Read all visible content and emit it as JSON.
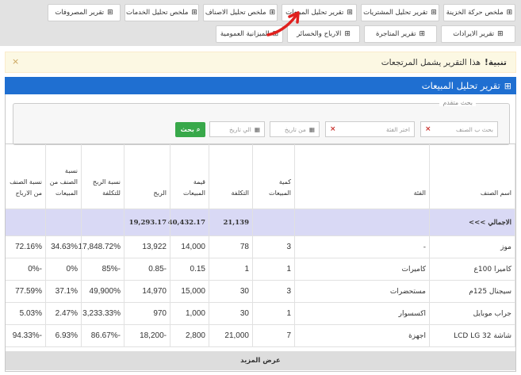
{
  "topnav": {
    "row1": [
      {
        "label": "ملخص حركة الخزينة",
        "icon": "grid-icon"
      },
      {
        "label": "تقرير تحليل المشتريات",
        "icon": "grid-icon"
      },
      {
        "label": "تقرير تحليل المبيعات",
        "icon": "grid-icon"
      },
      {
        "label": "ملخص تحليل الاصناف",
        "icon": "grid-icon"
      },
      {
        "label": "ملخص تحليل الخدمات",
        "icon": "grid-icon"
      },
      {
        "label": "تقرير المصروفات",
        "icon": "grid-icon"
      }
    ],
    "row2": [
      {
        "label": "تقرير الايرادات",
        "icon": "grid-icon"
      },
      {
        "label": "تقرير المتاجرة",
        "icon": "grid-icon"
      },
      {
        "label": "الارباح والخسائر",
        "icon": "grid-icon"
      },
      {
        "label": "الميزانية العمومية",
        "icon": "grid-icon"
      }
    ]
  },
  "alert": {
    "bold": "تنبية!",
    "text": "هذا التقرير يشمل المرتجعات",
    "close": "×"
  },
  "panel": {
    "title": "تقرير تحليل المبيعات",
    "icon": "grid-icon"
  },
  "search": {
    "legend": "بحث متقدم",
    "item_placeholder": "بحث ب الصنف",
    "category_placeholder": "اختر الفئة",
    "from_placeholder": "من تاريخ",
    "to_placeholder": "الي تاريخ",
    "button": "بحث",
    "clear_mark": "×"
  },
  "table": {
    "headers": [
      "اسم الصنف",
      "الفئة",
      "كمية المبيعات",
      "التكلفة",
      "قيمة المبيعات",
      "الربح",
      "نسبة الربح للتكلفة",
      "نسبة الصنف من المبيعات",
      "نسبة الصنف من الارباح"
    ],
    "total": {
      "label": "الاجمالي >>>",
      "qty": "",
      "cost": "21,139",
      "sales": "40,432.17",
      "profit": "19,293.17"
    },
    "rows": [
      {
        "name": "موز",
        "cat": "-",
        "qty": "3",
        "cost": "78",
        "sales": "14,000",
        "profit": "13,922",
        "profit_cost": "17,848.72%",
        "sales_pct": "34.63%",
        "profit_pct": "72.16%"
      },
      {
        "name": "كاميرا 100ع",
        "cat": "كاميرات",
        "qty": "1",
        "cost": "1",
        "sales": "0.15",
        "profit": "-0.85",
        "profit_cost": "-85%",
        "sales_pct": "0%",
        "profit_pct": "-0%"
      },
      {
        "name": "سيجنال 125م",
        "cat": "مستحضرات",
        "qty": "3",
        "cost": "30",
        "sales": "15,000",
        "profit": "14,970",
        "profit_cost": "49,900%",
        "sales_pct": "37.1%",
        "profit_pct": "77.59%"
      },
      {
        "name": "جراب موبايل",
        "cat": "اكسسوار",
        "qty": "1",
        "cost": "30",
        "sales": "1,000",
        "profit": "970",
        "profit_cost": "3,233.33%",
        "sales_pct": "2.47%",
        "profit_pct": "5.03%"
      },
      {
        "name": "شاشة LCD LG 32",
        "cat": "اجهزة",
        "qty": "7",
        "cost": "21,000",
        "sales": "2,800",
        "profit": "-18,200",
        "profit_cost": "-86.67%",
        "sales_pct": "6.93%",
        "profit_pct": "-94.33%"
      }
    ],
    "more": "عرض المزيد"
  }
}
